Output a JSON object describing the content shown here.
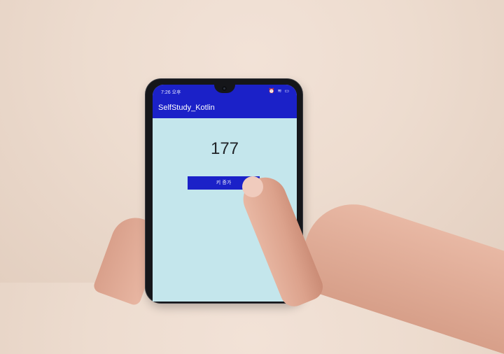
{
  "status_bar": {
    "time": "7:26 오후",
    "icons": [
      "alarm-icon",
      "wifi-icon",
      "battery-icon"
    ]
  },
  "app_bar": {
    "title": "SelfStudy_Kotlin"
  },
  "main": {
    "counter_value": "177",
    "button_label": "키 증가"
  },
  "colors": {
    "primary": "#1B21C8",
    "content_background": "#C4E6EC",
    "counter_text": "#1F2327"
  }
}
